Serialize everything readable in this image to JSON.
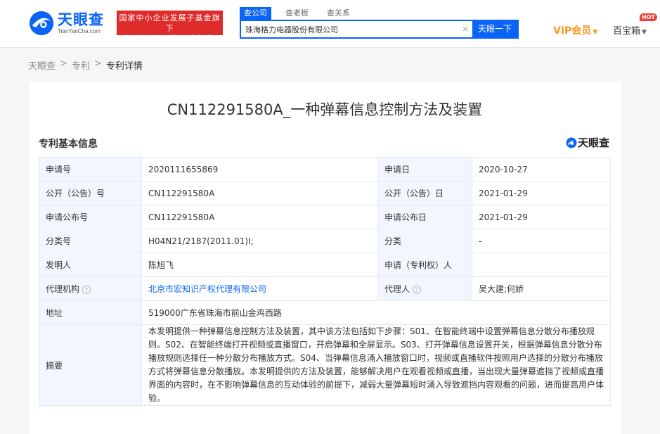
{
  "header": {
    "logo_cn": "天眼查",
    "logo_en": "TianYanCha.com",
    "slogan_line1": "国家中小企业发展子基金旗下",
    "slogan_line2": "官方备案企业征信机构",
    "search_tabs": [
      "查公司",
      "查老板",
      "查关系"
    ],
    "search_value": "珠海格力电器股份有限公司",
    "search_button": "天眼一下",
    "vip": "VIP会员",
    "baibao": "百宝箱",
    "hot": "HOT"
  },
  "breadcrumb": [
    "天眼查",
    "专利",
    "专利详情"
  ],
  "patent": {
    "title": "CN112291580A_一种弹幕信息控制方法及装置",
    "section": "专利基本信息",
    "brand": "天眼查",
    "rows": [
      {
        "l1": "申请号",
        "v1": "2020111655869",
        "l2": "申请日",
        "v2": "2020-10-27"
      },
      {
        "l1": "公开（公告）号",
        "v1": "CN112291580A",
        "l2": "公开（公告）日",
        "v2": "2021-01-29"
      },
      {
        "l1": "申请公布号",
        "v1": "CN112291580A",
        "l2": "申请公布日",
        "v2": "2021-01-29"
      },
      {
        "l1": "分类号",
        "v1": "H04N21/2187(2011.01)I;",
        "l2": "分类",
        "v2": "-"
      },
      {
        "l1": "发明人",
        "v1": "陈旭飞",
        "l2": "申请（专利权）人",
        "v2": ""
      },
      {
        "l1": "代理机构",
        "v1": "北京市宏知识产权代理有限公司",
        "l2": "代理人",
        "v2": "吴大建;何娇"
      }
    ],
    "address_label": "地址",
    "address": "519000广东省珠海市前山金鸡西路",
    "abstract_label": "摘要",
    "abstract": "本发明提供一种弹幕信息控制方法及装置，其中该方法包括如下步骤：S01、在智能终端中设置弹幕信息分散分布播放规则。S02、在智能终端打开视频或直播窗口，开启弹幕和全屏显示。S03、打开弹幕信息设置开关，根据弹幕信息分散分布播放规则选择任一种分散分布播放方式。S04、当弹幕信息涌入播放窗口时，视频或直播软件按照用户选择的分散分布播放方式将弹幕信息分散播放。本发明提供的方法及装置，能够解决用户在观看视频或直播，当出现大量弹幕遮挡了视频或直播界面的内容时，在不影响弹幕信息的互动体验的前提下，减弱大量弹幕短时涌入导致遮挡内容观看的问题，进而提高用户体验。"
  }
}
